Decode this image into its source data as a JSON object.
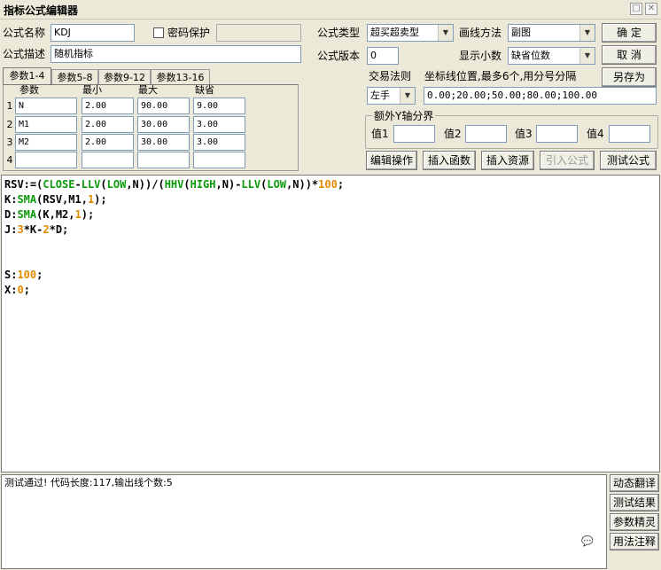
{
  "window": {
    "title": "指标公式编辑器",
    "restore_glyph": "□",
    "close_glyph": "✕"
  },
  "formula_name": {
    "label": "公式名称",
    "value": "KDJ"
  },
  "password": {
    "label": "密码保护",
    "value": ""
  },
  "formula_desc": {
    "label": "公式描述",
    "value": "随机指标"
  },
  "formula_type": {
    "label": "公式类型",
    "value": "超买超卖型"
  },
  "draw_method": {
    "label": "画线方法",
    "value": "副图"
  },
  "formula_version": {
    "label": "公式版本",
    "value": "0"
  },
  "show_decimal": {
    "label": "显示小数",
    "value": "缺省位数"
  },
  "buttons": {
    "ok": "确  定",
    "cancel": "取  消",
    "save_as": "另存为"
  },
  "tabs": [
    "参数1-4",
    "参数5-8",
    "参数9-12",
    "参数13-16"
  ],
  "param_headers": [
    "参数",
    "最小",
    "最大",
    "缺省"
  ],
  "params": [
    {
      "num": "1",
      "name": "N",
      "min": "2.00",
      "max": "90.00",
      "default": "9.00"
    },
    {
      "num": "2",
      "name": "M1",
      "min": "2.00",
      "max": "30.00",
      "default": "3.00"
    },
    {
      "num": "3",
      "name": "M2",
      "min": "2.00",
      "max": "30.00",
      "default": "3.00"
    },
    {
      "num": "4",
      "name": "",
      "min": "",
      "max": "",
      "default": ""
    }
  ],
  "trade_rule": {
    "label": "交易法则",
    "value": "左手"
  },
  "coord_lines": {
    "label": "坐标线位置,最多6个,用分号分隔",
    "value": "0.00;20.00;50.00;80.00;100.00"
  },
  "extra_y": {
    "legend": "额外Y轴分界",
    "labels": [
      "值1",
      "值2",
      "值3",
      "值4"
    ]
  },
  "action_buttons": {
    "edit": "编辑操作",
    "insert_func": "插入函数",
    "insert_res": "插入资源",
    "import": "引入公式",
    "test": "测试公式"
  },
  "code_lines": [
    [
      [
        "RSV:=(",
        "black"
      ],
      [
        "CLOSE",
        "green"
      ],
      [
        "-",
        "black"
      ],
      [
        "LLV",
        "green"
      ],
      [
        "(",
        "black"
      ],
      [
        "LOW",
        "green"
      ],
      [
        ",N))/(",
        "black"
      ],
      [
        "HHV",
        "green"
      ],
      [
        "(",
        "black"
      ],
      [
        "HIGH",
        "green"
      ],
      [
        ",N)-",
        "black"
      ],
      [
        "LLV",
        "green"
      ],
      [
        "(",
        "black"
      ],
      [
        "LOW",
        "green"
      ],
      [
        ",N))*",
        "black"
      ],
      [
        "100",
        "orange"
      ],
      [
        ";",
        "black"
      ]
    ],
    [
      [
        "K:",
        "black"
      ],
      [
        "SMA",
        "green"
      ],
      [
        "(RSV,M1,",
        "black"
      ],
      [
        "1",
        "orange"
      ],
      [
        ");",
        "black"
      ]
    ],
    [
      [
        "D:",
        "black"
      ],
      [
        "SMA",
        "green"
      ],
      [
        "(K,M2,",
        "black"
      ],
      [
        "1",
        "orange"
      ],
      [
        ");",
        "black"
      ]
    ],
    [
      [
        "J:",
        "black"
      ],
      [
        "3",
        "orange"
      ],
      [
        "*K-",
        "black"
      ],
      [
        "2",
        "orange"
      ],
      [
        "*D;",
        "black"
      ]
    ],
    [],
    [],
    [
      [
        "S:",
        "black"
      ],
      [
        "100",
        "orange"
      ],
      [
        ";",
        "black"
      ]
    ],
    [
      [
        "X:",
        "black"
      ],
      [
        "0",
        "orange"
      ],
      [
        ";",
        "black"
      ]
    ]
  ],
  "output_text": "测试通过! 代码长度:117,输出线个数:5",
  "side_buttons": [
    "动态翻译",
    "测试结果",
    "参数精灵",
    "用法注释"
  ],
  "watermark": "💬"
}
